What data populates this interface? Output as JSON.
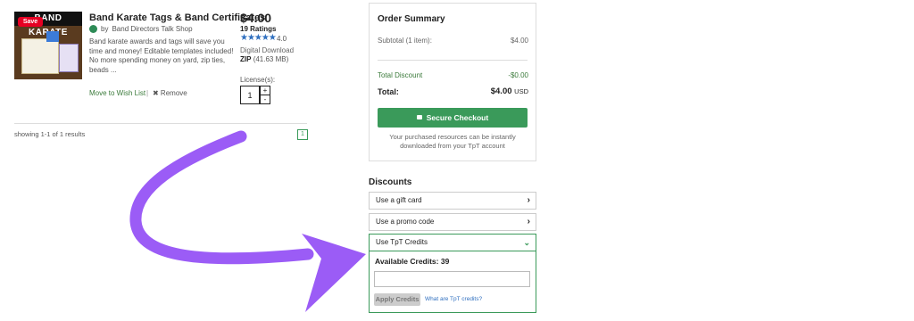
{
  "product": {
    "thumb_band_text": "BAND KARATE",
    "save_label": "Save",
    "title": "Band Karate Tags & Band Certificates",
    "author_prefix": "by",
    "author": "Band Directors Talk Shop",
    "description": "Band karate awards and tags will save you time and money! Editable templates included! No more spending money on yard, zip ties, beads ...",
    "move_to_wishlist": "Move to Wish List",
    "separator": "|",
    "remove": "✖ Remove",
    "price": "$4.00",
    "ratings_count": "19 Ratings",
    "stars": "★★★★★",
    "rating_value": "4.0",
    "download_type": "Digital Download",
    "file_type": "ZIP",
    "file_size": "(41.63 MB)",
    "licenses_label": "License(s):",
    "license_qty": "1",
    "stepper_up": "+",
    "stepper_down": "-"
  },
  "results": {
    "showing_text": "showing 1-1 of 1 results",
    "current_page": "1"
  },
  "order_summary": {
    "title": "Order Summary",
    "subtotal_label": "Subtotal (1 item):",
    "subtotal_value": "$4.00",
    "discount_label": "Total Discount",
    "discount_value": "-$0.00",
    "total_label": "Total:",
    "total_value": "$4.00",
    "total_currency": "USD",
    "checkout_label": "Secure Checkout",
    "note": "Your purchased resources can be instantly downloaded from your TpT account"
  },
  "discounts": {
    "title": "Discounts",
    "gift_card": "Use a gift card",
    "promo_code": "Use a promo code",
    "tpt_credits": "Use TpT Credits",
    "available_credits": "Available Credits: 39",
    "apply_label": "Apply Credits",
    "what_link": "What are TpT credits?",
    "chevron_right": "›",
    "chevron_down": "⌄"
  },
  "colors": {
    "accent_green": "#3a9a5a",
    "arrow_purple": "#9b5cf6",
    "star_blue": "#2f6fbf"
  }
}
